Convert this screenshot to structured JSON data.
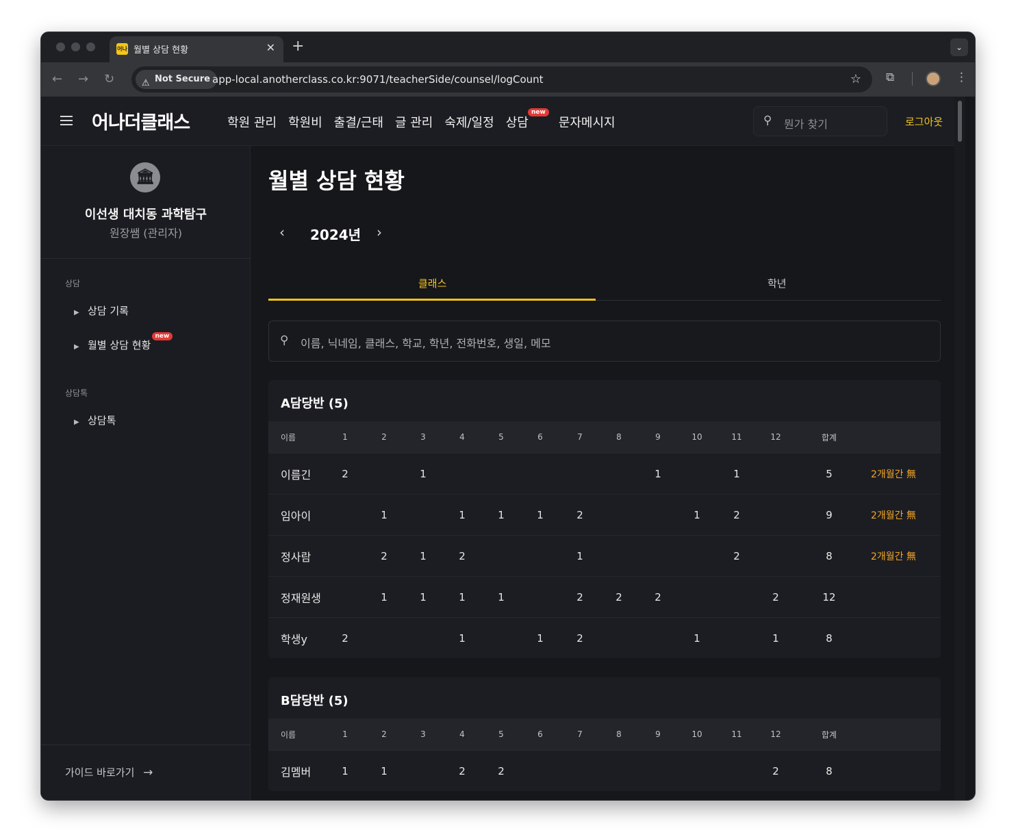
{
  "browser": {
    "tab_title": "월별 상담 현황",
    "tab_favicon_text": "어나",
    "not_secure": "Not Secure",
    "url": "app-local.anotherclass.co.kr:9071/teacherSide/counsel/logCount"
  },
  "header": {
    "logo": "어나더클래스",
    "nav": [
      {
        "label": "학원 관리"
      },
      {
        "label": "학원비"
      },
      {
        "label": "출결/근태"
      },
      {
        "label": "글 관리"
      },
      {
        "label": "숙제/일정"
      },
      {
        "label": "상담",
        "badge": "new"
      },
      {
        "label": "문자메시지"
      }
    ],
    "search_placeholder": "뭔가 찾기",
    "logout": "로그아웃"
  },
  "sidebar": {
    "academy_name": "이선생 대치동 과학탐구",
    "role": "원장쌤 (관리자)",
    "sections": [
      {
        "title": "상담",
        "items": [
          {
            "label": "상담 기록"
          },
          {
            "label": "월별 상담 현황",
            "badge": "new"
          }
        ]
      },
      {
        "title": "상담톡",
        "items": [
          {
            "label": "상담톡"
          }
        ]
      }
    ],
    "guide_link": "가이드 바로가기"
  },
  "main": {
    "title": "월별 상담 현황",
    "year": "2024년",
    "tabs": [
      {
        "label": "클래스",
        "active": true
      },
      {
        "label": "학년",
        "active": false
      }
    ],
    "search_placeholder": "이름, 닉네임, 클래스, 학교, 학년, 전화번호, 생일, 메모",
    "columns": [
      "이름",
      "1",
      "2",
      "3",
      "4",
      "5",
      "6",
      "7",
      "8",
      "9",
      "10",
      "11",
      "12",
      "합계"
    ],
    "groups": [
      {
        "title": "A담당반 (5)",
        "rows": [
          {
            "name": "이름긴",
            "months": [
              "2",
              "",
              "1",
              "",
              "",
              "",
              "",
              "",
              "1",
              "",
              "1",
              ""
            ],
            "total": "5",
            "warn": "2개월간 無"
          },
          {
            "name": "임아이",
            "months": [
              "",
              "1",
              "",
              "1",
              "1",
              "1",
              "2",
              "",
              "",
              "1",
              "2",
              ""
            ],
            "total": "9",
            "warn": "2개월간 無"
          },
          {
            "name": "정사람",
            "months": [
              "",
              "2",
              "1",
              "2",
              "",
              "",
              "1",
              "",
              "",
              "",
              "2",
              ""
            ],
            "total": "8",
            "warn": "2개월간 無"
          },
          {
            "name": "정재원생",
            "months": [
              "",
              "1",
              "1",
              "1",
              "1",
              "",
              "2",
              "2",
              "2",
              "",
              "",
              "2"
            ],
            "total": "12",
            "warn": ""
          },
          {
            "name": "학생y",
            "months": [
              "2",
              "",
              "",
              "1",
              "",
              "1",
              "2",
              "",
              "",
              "1",
              "",
              "1"
            ],
            "total": "8",
            "warn": ""
          }
        ]
      },
      {
        "title": "B담당반 (5)",
        "rows": [
          {
            "name": "김멤버",
            "months": [
              "1",
              "1",
              "",
              "2",
              "2",
              "",
              "",
              "",
              "",
              "",
              "",
              "2"
            ],
            "total": "8",
            "warn": ""
          }
        ]
      }
    ]
  }
}
